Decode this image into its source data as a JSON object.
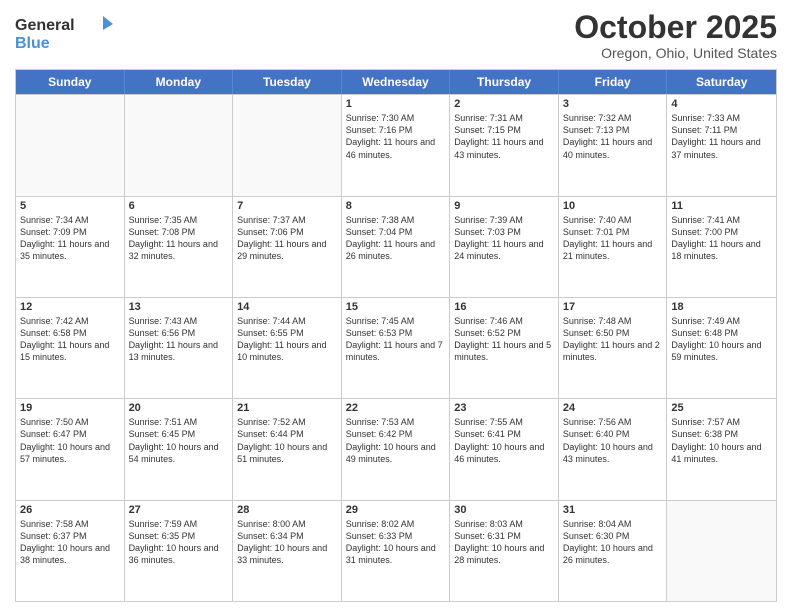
{
  "logo": {
    "general": "General",
    "blue": "Blue"
  },
  "title": "October 2025",
  "subtitle": "Oregon, Ohio, United States",
  "days": [
    "Sunday",
    "Monday",
    "Tuesday",
    "Wednesday",
    "Thursday",
    "Friday",
    "Saturday"
  ],
  "weeks": [
    [
      {
        "day": "",
        "text": ""
      },
      {
        "day": "",
        "text": ""
      },
      {
        "day": "",
        "text": ""
      },
      {
        "day": "1",
        "text": "Sunrise: 7:30 AM\nSunset: 7:16 PM\nDaylight: 11 hours and 46 minutes."
      },
      {
        "day": "2",
        "text": "Sunrise: 7:31 AM\nSunset: 7:15 PM\nDaylight: 11 hours and 43 minutes."
      },
      {
        "day": "3",
        "text": "Sunrise: 7:32 AM\nSunset: 7:13 PM\nDaylight: 11 hours and 40 minutes."
      },
      {
        "day": "4",
        "text": "Sunrise: 7:33 AM\nSunset: 7:11 PM\nDaylight: 11 hours and 37 minutes."
      }
    ],
    [
      {
        "day": "5",
        "text": "Sunrise: 7:34 AM\nSunset: 7:09 PM\nDaylight: 11 hours and 35 minutes."
      },
      {
        "day": "6",
        "text": "Sunrise: 7:35 AM\nSunset: 7:08 PM\nDaylight: 11 hours and 32 minutes."
      },
      {
        "day": "7",
        "text": "Sunrise: 7:37 AM\nSunset: 7:06 PM\nDaylight: 11 hours and 29 minutes."
      },
      {
        "day": "8",
        "text": "Sunrise: 7:38 AM\nSunset: 7:04 PM\nDaylight: 11 hours and 26 minutes."
      },
      {
        "day": "9",
        "text": "Sunrise: 7:39 AM\nSunset: 7:03 PM\nDaylight: 11 hours and 24 minutes."
      },
      {
        "day": "10",
        "text": "Sunrise: 7:40 AM\nSunset: 7:01 PM\nDaylight: 11 hours and 21 minutes."
      },
      {
        "day": "11",
        "text": "Sunrise: 7:41 AM\nSunset: 7:00 PM\nDaylight: 11 hours and 18 minutes."
      }
    ],
    [
      {
        "day": "12",
        "text": "Sunrise: 7:42 AM\nSunset: 6:58 PM\nDaylight: 11 hours and 15 minutes."
      },
      {
        "day": "13",
        "text": "Sunrise: 7:43 AM\nSunset: 6:56 PM\nDaylight: 11 hours and 13 minutes."
      },
      {
        "day": "14",
        "text": "Sunrise: 7:44 AM\nSunset: 6:55 PM\nDaylight: 11 hours and 10 minutes."
      },
      {
        "day": "15",
        "text": "Sunrise: 7:45 AM\nSunset: 6:53 PM\nDaylight: 11 hours and 7 minutes."
      },
      {
        "day": "16",
        "text": "Sunrise: 7:46 AM\nSunset: 6:52 PM\nDaylight: 11 hours and 5 minutes."
      },
      {
        "day": "17",
        "text": "Sunrise: 7:48 AM\nSunset: 6:50 PM\nDaylight: 11 hours and 2 minutes."
      },
      {
        "day": "18",
        "text": "Sunrise: 7:49 AM\nSunset: 6:48 PM\nDaylight: 10 hours and 59 minutes."
      }
    ],
    [
      {
        "day": "19",
        "text": "Sunrise: 7:50 AM\nSunset: 6:47 PM\nDaylight: 10 hours and 57 minutes."
      },
      {
        "day": "20",
        "text": "Sunrise: 7:51 AM\nSunset: 6:45 PM\nDaylight: 10 hours and 54 minutes."
      },
      {
        "day": "21",
        "text": "Sunrise: 7:52 AM\nSunset: 6:44 PM\nDaylight: 10 hours and 51 minutes."
      },
      {
        "day": "22",
        "text": "Sunrise: 7:53 AM\nSunset: 6:42 PM\nDaylight: 10 hours and 49 minutes."
      },
      {
        "day": "23",
        "text": "Sunrise: 7:55 AM\nSunset: 6:41 PM\nDaylight: 10 hours and 46 minutes."
      },
      {
        "day": "24",
        "text": "Sunrise: 7:56 AM\nSunset: 6:40 PM\nDaylight: 10 hours and 43 minutes."
      },
      {
        "day": "25",
        "text": "Sunrise: 7:57 AM\nSunset: 6:38 PM\nDaylight: 10 hours and 41 minutes."
      }
    ],
    [
      {
        "day": "26",
        "text": "Sunrise: 7:58 AM\nSunset: 6:37 PM\nDaylight: 10 hours and 38 minutes."
      },
      {
        "day": "27",
        "text": "Sunrise: 7:59 AM\nSunset: 6:35 PM\nDaylight: 10 hours and 36 minutes."
      },
      {
        "day": "28",
        "text": "Sunrise: 8:00 AM\nSunset: 6:34 PM\nDaylight: 10 hours and 33 minutes."
      },
      {
        "day": "29",
        "text": "Sunrise: 8:02 AM\nSunset: 6:33 PM\nDaylight: 10 hours and 31 minutes."
      },
      {
        "day": "30",
        "text": "Sunrise: 8:03 AM\nSunset: 6:31 PM\nDaylight: 10 hours and 28 minutes."
      },
      {
        "day": "31",
        "text": "Sunrise: 8:04 AM\nSunset: 6:30 PM\nDaylight: 10 hours and 26 minutes."
      },
      {
        "day": "",
        "text": ""
      }
    ]
  ]
}
